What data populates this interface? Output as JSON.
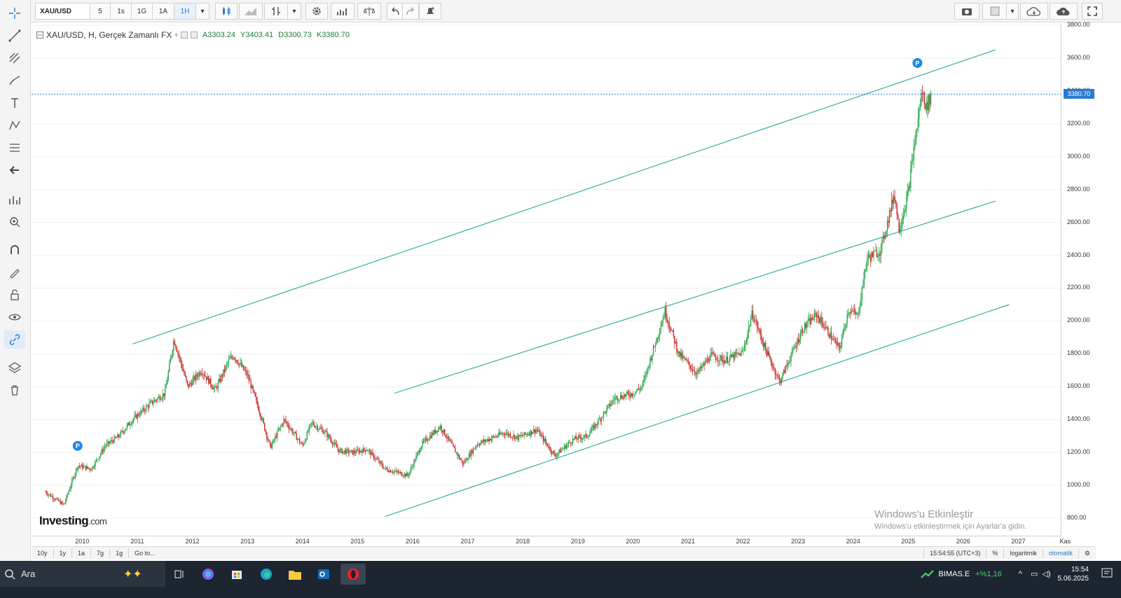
{
  "toolbar": {
    "symbol": "XAU/USD",
    "intervals": [
      "5",
      "1s",
      "1G",
      "1A",
      "1H"
    ],
    "active_interval": "1H"
  },
  "legend": {
    "title": "XAU/USD, H, Gerçek Zamanlı FX",
    "open_label": "A",
    "open": "3303.24",
    "high_label": "Y",
    "high": "3403.41",
    "low_label": "D",
    "low": "3300.73",
    "close_label": "K",
    "close": "3380.70"
  },
  "price_axis": {
    "ticks": [
      "3800.00",
      "3600.00",
      "3400.00",
      "3200.00",
      "3000.00",
      "2800.00",
      "2600.00",
      "2400.00",
      "2200.00",
      "2000.00",
      "1800.00",
      "1600.00",
      "1400.00",
      "1200.00",
      "1000.00",
      "800.00"
    ],
    "last_price": "3380.70"
  },
  "time_axis": {
    "ticks": [
      "2010",
      "2011",
      "2012",
      "2013",
      "2014",
      "2015",
      "2016",
      "2017",
      "2018",
      "2019",
      "2020",
      "2021",
      "2022",
      "2023",
      "2024",
      "2025",
      "2026",
      "2027",
      "Kas"
    ]
  },
  "period_bar": {
    "ranges": [
      "10y",
      "1y",
      "1a",
      "7g",
      "1g",
      "Go to..."
    ],
    "time": "15:54:55 (UTC+3)",
    "percent": "%",
    "log": "logaritmik",
    "auto": "otomatik"
  },
  "logo": {
    "brand": "Investing",
    "suffix": ".com"
  },
  "watermark": {
    "title": "Windows'u Etkinleştir",
    "subtitle": "Windows'u etkinleştirmek için Ayarlar'a gidin."
  },
  "taskbar": {
    "search": "Ara",
    "stock_name": "BIMAS.E",
    "stock_change": "+%1,16",
    "time": "15:54",
    "date": "5.06.2025"
  },
  "chart_data": {
    "type": "line",
    "title": "",
    "series": [
      {
        "x": [
          "2009-05",
          "2009-09",
          "2009-12",
          "2010-03",
          "2010-06",
          "2010-09",
          "2010-12",
          "2011-04",
          "2011-07",
          "2011-09",
          "2011-12",
          "2012-03",
          "2012-06",
          "2012-09",
          "2012-10",
          "2013-01",
          "2013-04",
          "2013-06",
          "2013-09",
          "2014-01",
          "2014-03",
          "2014-06",
          "2014-09",
          "2014-12",
          "2015-03",
          "2015-07",
          "2015-12",
          "2016-03",
          "2016-07",
          "2016-12",
          "2017-03",
          "2017-09",
          "2017-12",
          "2018-04",
          "2018-08",
          "2018-12",
          "2019-03",
          "2019-06",
          "2019-09",
          "2020-01",
          "2020-03",
          "2020-08",
          "2020-11",
          "2021-03",
          "2021-06",
          "2021-09",
          "2022-01",
          "2022-03",
          "2022-06",
          "2022-09",
          "2022-11",
          "2023-02",
          "2023-05",
          "2023-10",
          "2023-12",
          "2024-02",
          "2024-04",
          "2024-07",
          "2024-10",
          "2024-11",
          "2025-01",
          "2025-02",
          "2025-04",
          "2025-05",
          "2025-06"
        ],
        "values": [
          960,
          880,
          1120,
          1100,
          1240,
          1300,
          1400,
          1500,
          1560,
          1890,
          1600,
          1700,
          1580,
          1760,
          1790,
          1670,
          1420,
          1230,
          1400,
          1240,
          1380,
          1320,
          1210,
          1200,
          1220,
          1100,
          1060,
          1250,
          1360,
          1130,
          1250,
          1320,
          1290,
          1340,
          1180,
          1280,
          1300,
          1410,
          1530,
          1560,
          1600,
          2060,
          1800,
          1680,
          1790,
          1760,
          1810,
          2050,
          1820,
          1630,
          1760,
          1950,
          2040,
          1830,
          2070,
          2030,
          2380,
          2430,
          2780,
          2560,
          2780,
          3000,
          3400,
          3300,
          3380
        ]
      }
    ],
    "ylim": [
      800,
      3800
    ],
    "channel_lines": [
      {
        "x": [
          "2010-12",
          "2026-08"
        ],
        "values": [
          1860,
          3650
        ]
      },
      {
        "x": [
          "2015-09",
          "2026-08"
        ],
        "values": [
          1560,
          2730
        ]
      },
      {
        "x": [
          "2015-07",
          "2026-11"
        ],
        "values": [
          810,
          2100
        ]
      }
    ],
    "markers": [
      {
        "x": "2009-12",
        "value": 1240,
        "label": "P"
      },
      {
        "x": "2025-03",
        "value": 3570,
        "label": "P"
      }
    ],
    "grid": true,
    "colors": {
      "up": "#26a64a",
      "down": "#cc2b2b",
      "channel": "#2aa79a",
      "last_price": "#2a7bd4"
    }
  }
}
